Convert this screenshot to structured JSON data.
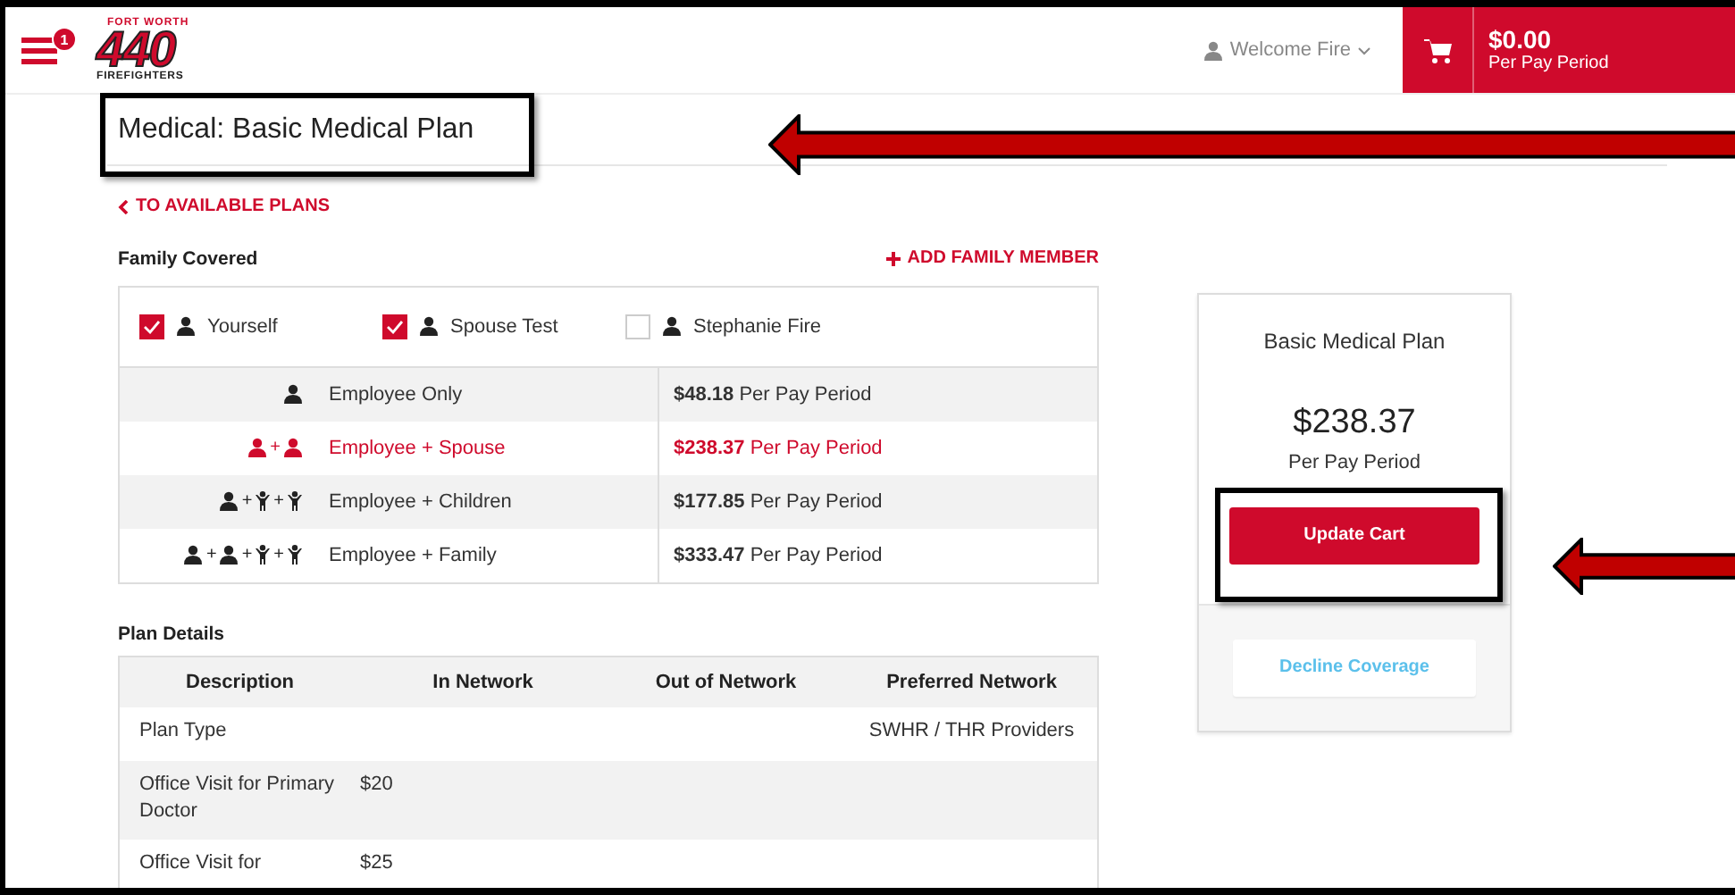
{
  "header": {
    "notification_count": "1",
    "logo": {
      "top": "FORT WORTH",
      "number": "440",
      "bottom": "FIREFIGHTERS"
    },
    "user_menu": "Welcome Fire",
    "cart": {
      "total": "$0.00",
      "period": "Per Pay Period"
    }
  },
  "page_title": "Medical: Basic Medical Plan",
  "back_link": "TO AVAILABLE PLANS",
  "family": {
    "heading": "Family Covered",
    "add_link": "ADD FAMILY MEMBER",
    "members": [
      {
        "name": "Yourself",
        "checked": true
      },
      {
        "name": "Spouse Test",
        "checked": true
      },
      {
        "name": "Stephanie Fire",
        "checked": false
      }
    ],
    "tiers": [
      {
        "icons": [
          {
            "kind": "adult"
          }
        ],
        "label": "Employee Only",
        "price": "**$48.18** Per Pay Period",
        "selected": false
      },
      {
        "icons": [
          {
            "kind": "adult"
          },
          {
            "kind": "plus",
            "text": "+"
          },
          {
            "kind": "adult"
          }
        ],
        "label": "Employee + Spouse",
        "price": "**$238.37** Per Pay Period",
        "selected": true
      },
      {
        "icons": [
          {
            "kind": "adult"
          },
          {
            "kind": "plus",
            "text": "+"
          },
          {
            "kind": "child"
          },
          {
            "kind": "plus",
            "text": "+"
          },
          {
            "kind": "child"
          }
        ],
        "label": "Employee + Children",
        "price": "**$177.85** Per Pay Period",
        "selected": false
      },
      {
        "icons": [
          {
            "kind": "adult"
          },
          {
            "kind": "plus",
            "text": "+"
          },
          {
            "kind": "adult"
          },
          {
            "kind": "plus",
            "text": "+"
          },
          {
            "kind": "child"
          },
          {
            "kind": "plus",
            "text": "+"
          },
          {
            "kind": "child"
          }
        ],
        "label": "Employee + Family",
        "price": "**$333.47** Per Pay Period",
        "selected": false
      }
    ]
  },
  "plan_details": {
    "heading": "Plan Details",
    "columns": [
      "Description",
      "In Network",
      "Out of Network",
      "Preferred Network"
    ],
    "rows": [
      {
        "description": "Plan Type",
        "preferred_network": "SWHR / THR Providers"
      },
      {
        "description": "Office Visit for Primary Doctor",
        "in_network": "$20"
      },
      {
        "description": "Office Visit for",
        "in_network": "$25"
      }
    ]
  },
  "summary": {
    "plan": "Basic Medical Plan",
    "price": "$238.37",
    "period": "Per Pay Period",
    "primary_button": "Update Cart",
    "secondary_button": "Decline Coverage"
  }
}
